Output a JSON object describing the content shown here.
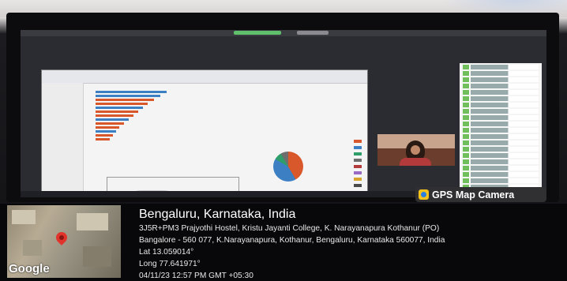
{
  "badge": {
    "label": "GPS Map Camera",
    "icon": "gps-map-camera-icon"
  },
  "minimap": {
    "brand": "Google",
    "pin_icon": "map-pin-icon"
  },
  "location": {
    "title": "Bengaluru, Karnataka, India",
    "address_line1": "3J5R+PM3 Prajyothi Hostel, Kristu Jayanti College, K. Narayanapura Kothanur (PO)",
    "address_line2": "Bangalore - 560 077, K.Narayanapura, Kothanur, Bengaluru, Karnataka 560077, India",
    "lat": "Lat 13.059014°",
    "long": "Long 77.641971°",
    "datetime": "04/11/23 12:57 PM GMT +05:30"
  },
  "colors": {
    "pin": "#e0332b",
    "badge_icon": "#f4c21b",
    "overlay": "#08080a"
  }
}
